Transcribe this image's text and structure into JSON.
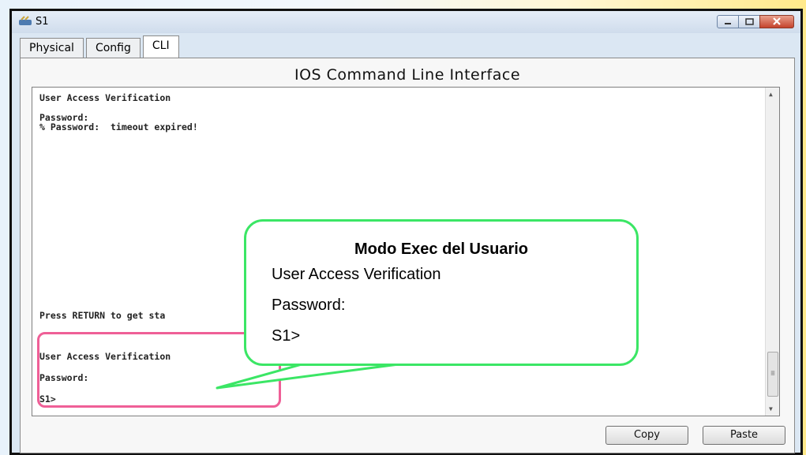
{
  "window": {
    "title": "S1"
  },
  "tabs": [
    {
      "label": "Physical"
    },
    {
      "label": "Config"
    },
    {
      "label": "CLI"
    }
  ],
  "panel": {
    "title": "IOS Command Line Interface"
  },
  "terminal": {
    "lines": [
      "User Access Verification",
      "Password:",
      "% Password:  timeout expired!",
      "Press RETURN to get sta",
      "User Access Verification",
      "Password:",
      "S1>"
    ]
  },
  "buttons": {
    "copy": "Copy",
    "paste": "Paste"
  },
  "callout": {
    "title": "Modo Exec del Usuario",
    "line1": "User Access Verification",
    "line2": "Password:",
    "line3": "S1>"
  },
  "colors": {
    "callout_border": "#3be665",
    "highlight_border": "#ef5f97"
  }
}
